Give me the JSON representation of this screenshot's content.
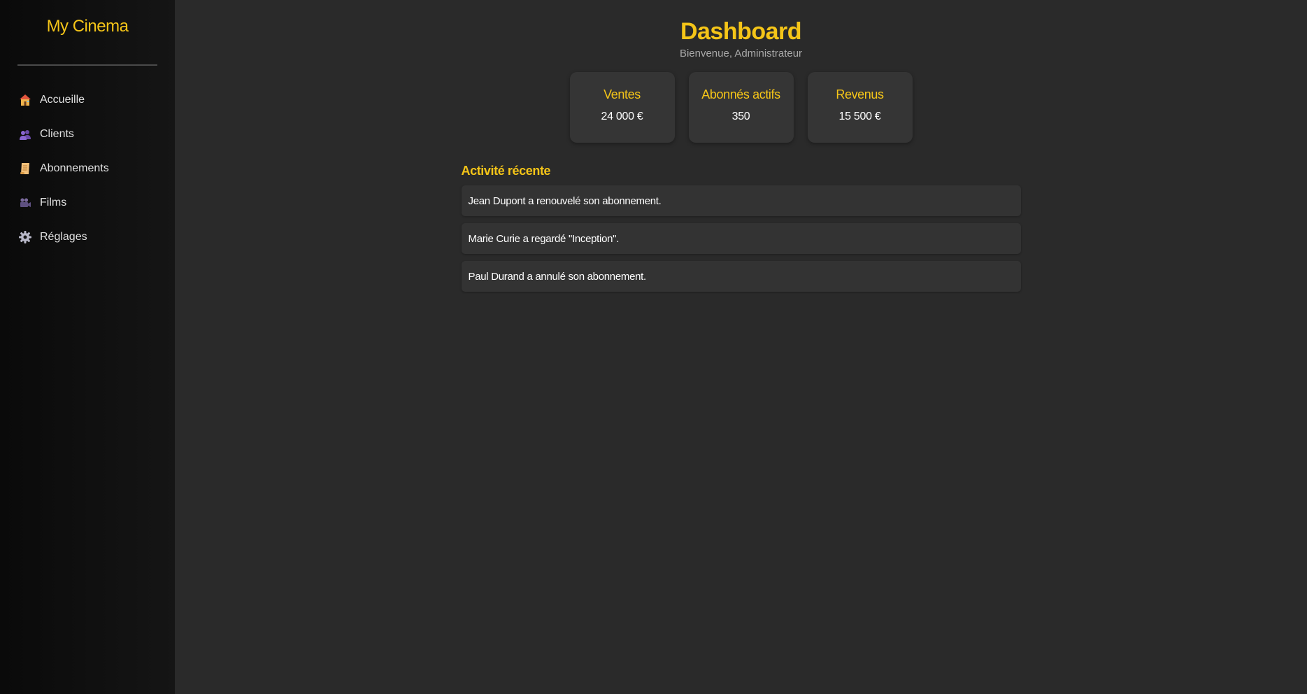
{
  "sidebar": {
    "brand": "My Cinema",
    "items": [
      {
        "label": "Accueille",
        "icon": "house-icon"
      },
      {
        "label": "Clients",
        "icon": "users-icon"
      },
      {
        "label": "Abonnements",
        "icon": "scroll-icon"
      },
      {
        "label": "Films",
        "icon": "movie-camera-icon"
      },
      {
        "label": "Réglages",
        "icon": "gear-icon"
      }
    ]
  },
  "header": {
    "title": "Dashboard",
    "subtitle": "Bienvenue, Administrateur"
  },
  "stats": [
    {
      "label": "Ventes",
      "value": "24 000 €"
    },
    {
      "label": "Abonnés actifs",
      "value": "350"
    },
    {
      "label": "Revenus",
      "value": "15 500 €"
    }
  ],
  "activity": {
    "title": "Activité récente",
    "items": [
      "Jean Dupont a renouvelé son abonnement.",
      "Marie Curie a regardé \"Inception\".",
      "Paul Durand a annulé son abonnement."
    ]
  },
  "colors": {
    "accent": "#f5c518",
    "background": "#2a2a2a",
    "sidebar": "#111111",
    "card": "#353535"
  }
}
